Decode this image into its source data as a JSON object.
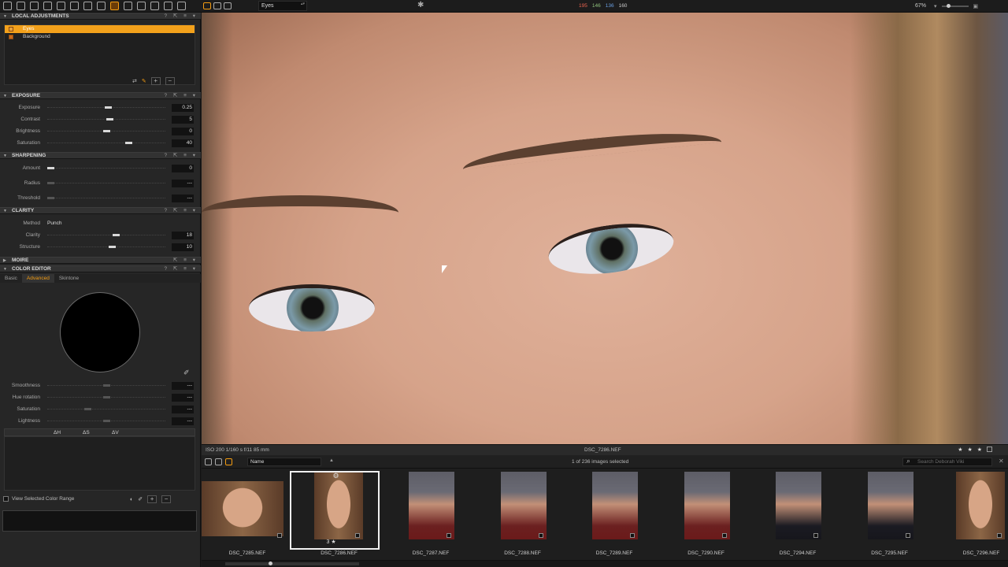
{
  "toolbar": {
    "layer_selector": "Eyes",
    "readout": {
      "r": "195",
      "g": "146",
      "b": "136",
      "l": "160"
    },
    "zoom": "67%"
  },
  "local_adjustments": {
    "title": "LOCAL ADJUSTMENTS",
    "layers": [
      {
        "name": "Eyes",
        "selected": true
      },
      {
        "name": "Background",
        "selected": false
      }
    ]
  },
  "exposure": {
    "title": "EXPOSURE",
    "rows": [
      {
        "label": "Exposure",
        "value": "0.25",
        "level": 0.52
      },
      {
        "label": "Contrast",
        "value": "5",
        "level": 0.53
      },
      {
        "label": "Brightness",
        "value": "0",
        "level": 0.5
      },
      {
        "label": "Saturation",
        "value": "40",
        "level": 0.7
      }
    ]
  },
  "sharpening": {
    "title": "SHARPENING",
    "rows": [
      {
        "label": "Amount",
        "value": "0",
        "level": 0.0
      },
      {
        "label": "Radius",
        "value": "---",
        "level": 0.0
      },
      {
        "label": "Threshold",
        "value": "---",
        "level": 0.0
      }
    ]
  },
  "clarity": {
    "title": "CLARITY",
    "method_label": "Method",
    "method_value": "Punch",
    "rows": [
      {
        "label": "Clarity",
        "value": "18",
        "level": 0.59
      },
      {
        "label": "Structure",
        "value": "10",
        "level": 0.55
      }
    ]
  },
  "moire": {
    "title": "MOIRE"
  },
  "color_editor": {
    "title": "COLOR EDITOR",
    "tabs": [
      {
        "label": "Basic",
        "active": false
      },
      {
        "label": "Advanced",
        "active": true
      },
      {
        "label": "Skintone",
        "active": false
      }
    ],
    "rows": [
      {
        "label": "Smoothness",
        "value": "---",
        "level": 0.5
      },
      {
        "label": "Hue rotation",
        "value": "---",
        "level": 0.5
      },
      {
        "label": "Saturation",
        "value": "---",
        "level": 0.33
      },
      {
        "label": "Lightness",
        "value": "---",
        "level": 0.5
      }
    ],
    "delta_headers": [
      "ΔH",
      "ΔS",
      "ΔV"
    ],
    "view_selected": "View Selected Color Range"
  },
  "viewer": {
    "exif": "ISO 200  1/160 s  f/11  85 mm",
    "filename": "DSC_7286.NEF",
    "stars": "★ ★ ★"
  },
  "browser": {
    "sort": "Name",
    "selection": "1 of 236 images selected",
    "search_placeholder": "Search Deborah Viki",
    "thumbs": [
      {
        "name": "DSC_7285.NEF",
        "selected": false,
        "style": "wide"
      },
      {
        "name": "DSC_7286.NEF",
        "selected": true,
        "style": "face"
      },
      {
        "name": "DSC_7287.NEF",
        "selected": false,
        "style": "red"
      },
      {
        "name": "DSC_7288.NEF",
        "selected": false,
        "style": "red"
      },
      {
        "name": "DSC_7289.NEF",
        "selected": false,
        "style": "red"
      },
      {
        "name": "DSC_7290.NEF",
        "selected": false,
        "style": "red"
      },
      {
        "name": "DSC_7294.NEF",
        "selected": false,
        "style": "dark"
      },
      {
        "name": "DSC_7295.NEF",
        "selected": false,
        "style": "dark"
      },
      {
        "name": "DSC_7296.NEF",
        "selected": false,
        "style": "face"
      }
    ],
    "selected_rating": "3 ★"
  },
  "icons": [
    "cursor-icon",
    "camera-icon",
    "crop-icon",
    "brush-icon",
    "magnifier-icon",
    "eyedropper-icon",
    "search-icon"
  ],
  "colors": {
    "accent": "#f39c12",
    "panel": "#262626",
    "background": "#1b1b1b"
  }
}
